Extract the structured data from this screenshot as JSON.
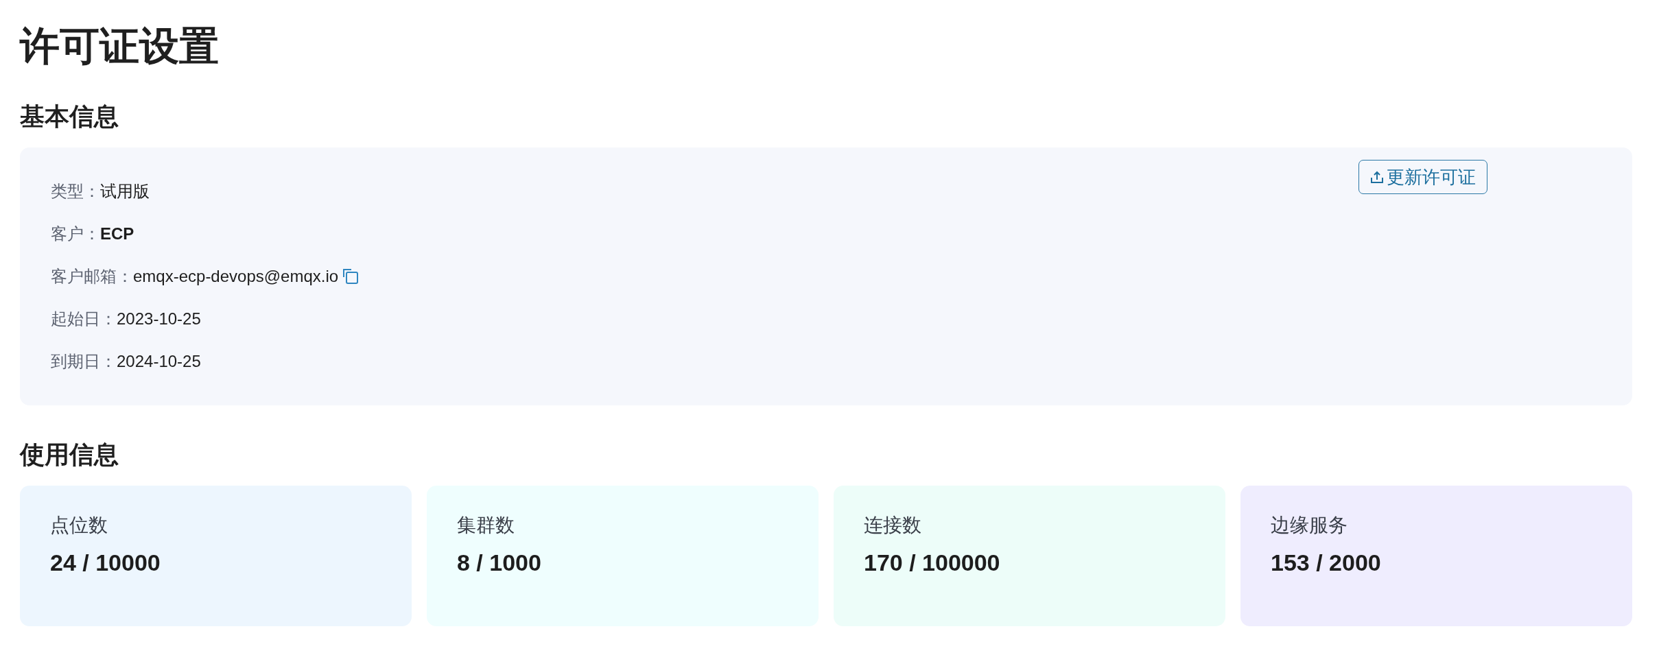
{
  "page_title": "许可证设置",
  "basic_info": {
    "heading": "基本信息",
    "update_button": "更新许可证",
    "fields": [
      {
        "kind": "plain",
        "label": "类型：",
        "value": "试用版"
      },
      {
        "kind": "bold",
        "label": "客户：",
        "value": "ECP"
      },
      {
        "kind": "copyable",
        "label": "客户邮箱：",
        "value": "emqx-ecp-devops@emqx.io"
      },
      {
        "kind": "plain",
        "label": "起始日：",
        "value": "2023-10-25"
      },
      {
        "kind": "plain",
        "label": "到期日：",
        "value": "2024-10-25"
      }
    ]
  },
  "usage_info": {
    "heading": "使用信息",
    "cards": [
      {
        "label": "点位数",
        "value": "24 / 10000",
        "color": "#edf6fe"
      },
      {
        "label": "集群数",
        "value": "8 / 1000",
        "color": "#effefe"
      },
      {
        "label": "连接数",
        "value": "170 / 100000",
        "color": "#edfdf9"
      },
      {
        "label": "边缘服务",
        "value": "153 / 2000",
        "color": "#efedfe"
      }
    ]
  }
}
